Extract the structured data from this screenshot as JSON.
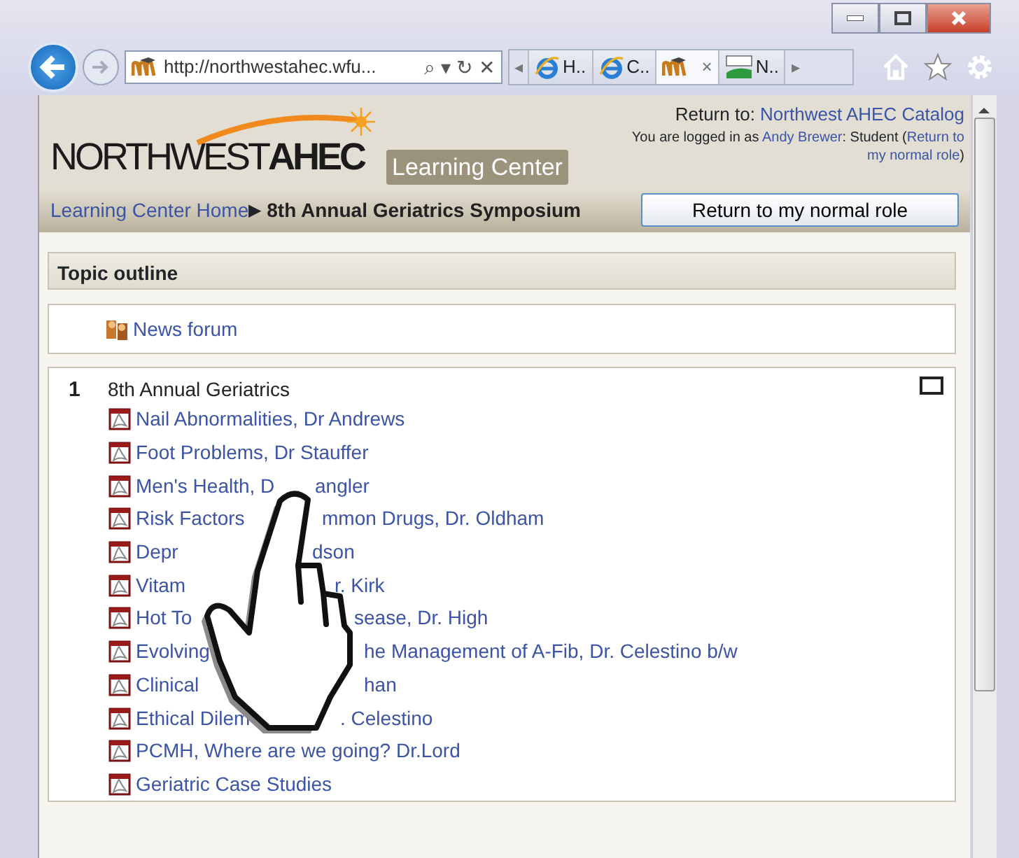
{
  "browser": {
    "address": "http://northwestahec.wfu...",
    "address_glyphs": [
      "⌕",
      "▾",
      "↻",
      "✕"
    ],
    "tabs": [
      {
        "label": "H..",
        "kind": "ie",
        "selected": false
      },
      {
        "label": "C..",
        "kind": "ie",
        "selected": false
      },
      {
        "kind": "moodle",
        "selected": true,
        "close": "×"
      },
      {
        "label": "N..",
        "kind": "ahec",
        "selected": false
      }
    ],
    "tab_arrows": [
      "◂",
      "▸"
    ]
  },
  "header": {
    "logo": {
      "light": "NORTHWEST",
      "bold": "AHEC",
      "subtitle": "Learning Center"
    },
    "return_to": {
      "label": "Return to: ",
      "link": "Northwest AHEC Catalog"
    },
    "login_lines": [
      [
        {
          "text": "You are logged in as ",
          "kind": "text"
        },
        {
          "text": "Andy Brewer",
          "kind": "link"
        },
        {
          "text": ": Student (",
          "kind": "text"
        },
        {
          "text": "Return to",
          "kind": "link"
        }
      ],
      [
        {
          "text": "my normal role",
          "kind": "link"
        },
        {
          "text": ")",
          "kind": "text"
        }
      ]
    ]
  },
  "breadcrumb": {
    "home": "Learning Center Home",
    "separator": "▶",
    "current": "8th Annual Geriatrics Symposium"
  },
  "role_button": "Return to my normal role",
  "topic_outline": "Topic outline",
  "news_forum": "News forum",
  "section": {
    "number": "1",
    "title": "8th Annual Geriatrics",
    "resources": [
      {
        "parts": [
          "Nail Abnormalities, Dr Andrews"
        ]
      },
      {
        "parts": [
          "Foot Problems, Dr Stauffer"
        ]
      },
      {
        "parts": [
          "Men's Health, D",
          "angler"
        ]
      },
      {
        "parts": [
          "Risk Factors",
          "mmon Drugs, Dr. Oldham"
        ]
      },
      {
        "parts": [
          "Depr",
          "dson"
        ]
      },
      {
        "parts": [
          "Vitam",
          "r. Kirk"
        ]
      },
      {
        "parts": [
          "Hot To",
          "sease, Dr. High"
        ]
      },
      {
        "parts": [
          "Evolving",
          "he Management of A-Fib, Dr. Celestino b/w"
        ]
      },
      {
        "parts": [
          "Clinical",
          "han"
        ]
      },
      {
        "parts": [
          "Ethical Dilem",
          ". Celestino"
        ]
      },
      {
        "parts": [
          "PCMH, Where are we going? Dr.Lord"
        ]
      },
      {
        "parts": [
          "Geriatric Case Studies"
        ]
      }
    ]
  }
}
